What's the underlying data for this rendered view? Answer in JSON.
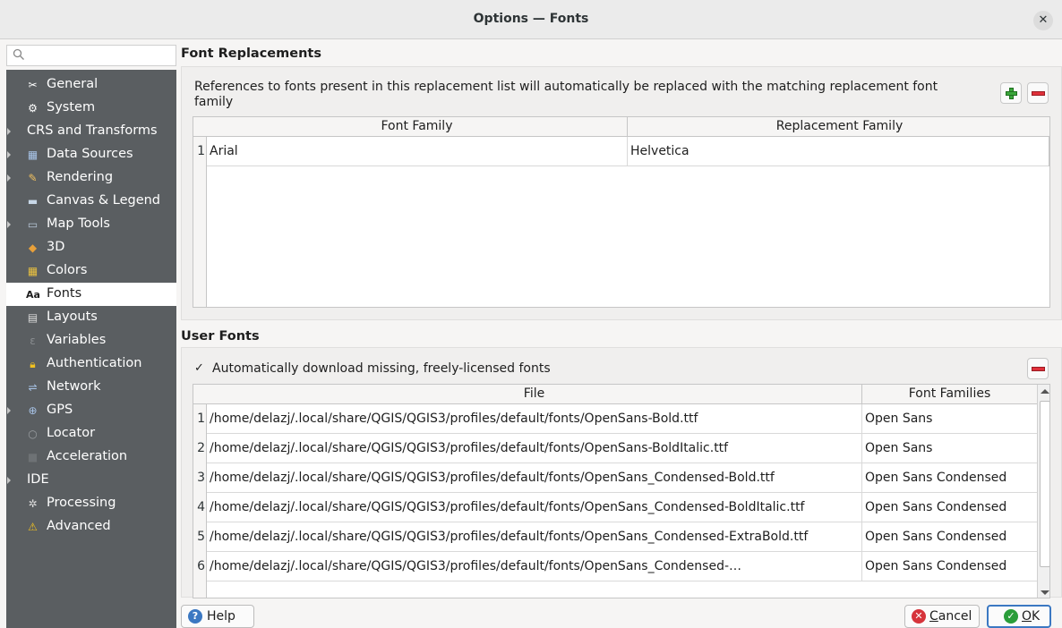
{
  "window": {
    "title": "Options — Fonts"
  },
  "sidebar": {
    "search_placeholder": "",
    "items": [
      {
        "label": "General",
        "icon": "wrench-screwdriver-icon",
        "expandable": false
      },
      {
        "label": "System",
        "icon": "gear-system-icon",
        "expandable": false
      },
      {
        "label": "CRS and Transforms",
        "icon": "",
        "expandable": true
      },
      {
        "label": "Data Sources",
        "icon": "table-icon",
        "expandable": true
      },
      {
        "label": "Rendering",
        "icon": "paintbrush-icon",
        "expandable": true
      },
      {
        "label": "Canvas & Legend",
        "icon": "canvas-icon",
        "expandable": false
      },
      {
        "label": "Map Tools",
        "icon": "map-tools-icon",
        "expandable": true
      },
      {
        "label": "3D",
        "icon": "cube-3d-icon",
        "expandable": false
      },
      {
        "label": "Colors",
        "icon": "colors-icon",
        "expandable": false
      },
      {
        "label": "Fonts",
        "icon": "fonts-icon",
        "expandable": false,
        "selected": true
      },
      {
        "label": "Layouts",
        "icon": "layout-icon",
        "expandable": false
      },
      {
        "label": "Variables",
        "icon": "variables-icon",
        "expandable": false
      },
      {
        "label": "Authentication",
        "icon": "lock-icon",
        "expandable": false
      },
      {
        "label": "Network",
        "icon": "network-icon",
        "expandable": false
      },
      {
        "label": "GPS",
        "icon": "gps-icon",
        "expandable": true
      },
      {
        "label": "Locator",
        "icon": "locator-search-icon",
        "expandable": false
      },
      {
        "label": "Acceleration",
        "icon": "acceleration-icon",
        "expandable": false
      },
      {
        "label": "IDE",
        "icon": "",
        "expandable": true
      },
      {
        "label": "Processing",
        "icon": "processing-gear-icon",
        "expandable": false
      },
      {
        "label": "Advanced",
        "icon": "warning-icon",
        "expandable": false
      }
    ]
  },
  "font_replacements": {
    "title": "Font Replacements",
    "description": "References to fonts present in this replacement list will automatically be replaced with the matching replacement font family",
    "columns": [
      "Font Family",
      "Replacement Family"
    ],
    "rows": [
      {
        "num": "1",
        "family": "Arial",
        "replacement": "Helvetica"
      }
    ]
  },
  "user_fonts": {
    "title": "User Fonts",
    "auto_download_label": "Automatically download missing, freely-licensed fonts",
    "auto_download_checked": true,
    "columns": [
      "File",
      "Font Families"
    ],
    "rows": [
      {
        "num": "1",
        "file": "/home/delazj/.local/share/QGIS/QGIS3/profiles/default/fonts/OpenSans-Bold.ttf",
        "families": "Open Sans"
      },
      {
        "num": "2",
        "file": "/home/delazj/.local/share/QGIS/QGIS3/profiles/default/fonts/OpenSans-BoldItalic.ttf",
        "families": "Open Sans"
      },
      {
        "num": "3",
        "file": "/home/delazj/.local/share/QGIS/QGIS3/profiles/default/fonts/OpenSans_Condensed-Bold.ttf",
        "families": "Open Sans Condensed"
      },
      {
        "num": "4",
        "file": "/home/delazj/.local/share/QGIS/QGIS3/profiles/default/fonts/OpenSans_Condensed-BoldItalic.ttf",
        "families": "Open Sans Condensed"
      },
      {
        "num": "5",
        "file": "/home/delazj/.local/share/QGIS/QGIS3/profiles/default/fonts/OpenSans_Condensed-ExtraBold.ttf",
        "families": "Open Sans Condensed"
      },
      {
        "num": "6",
        "file": "/home/delazj/.local/share/QGIS/QGIS3/profiles/default/fonts/OpenSans_Condensed-…",
        "families": "Open Sans Condensed"
      }
    ]
  },
  "buttons": {
    "help_label": "Help",
    "cancel_prefix": "",
    "cancel_mnemonic": "C",
    "cancel_rest": "ancel",
    "ok_mnemonic": "O",
    "ok_rest": "K"
  },
  "colors": {
    "sidebar_bg": "#5a5e61",
    "ok_icon": "#2a9d3a",
    "cancel_icon": "#d6343b",
    "help_icon": "#3b78c2"
  }
}
